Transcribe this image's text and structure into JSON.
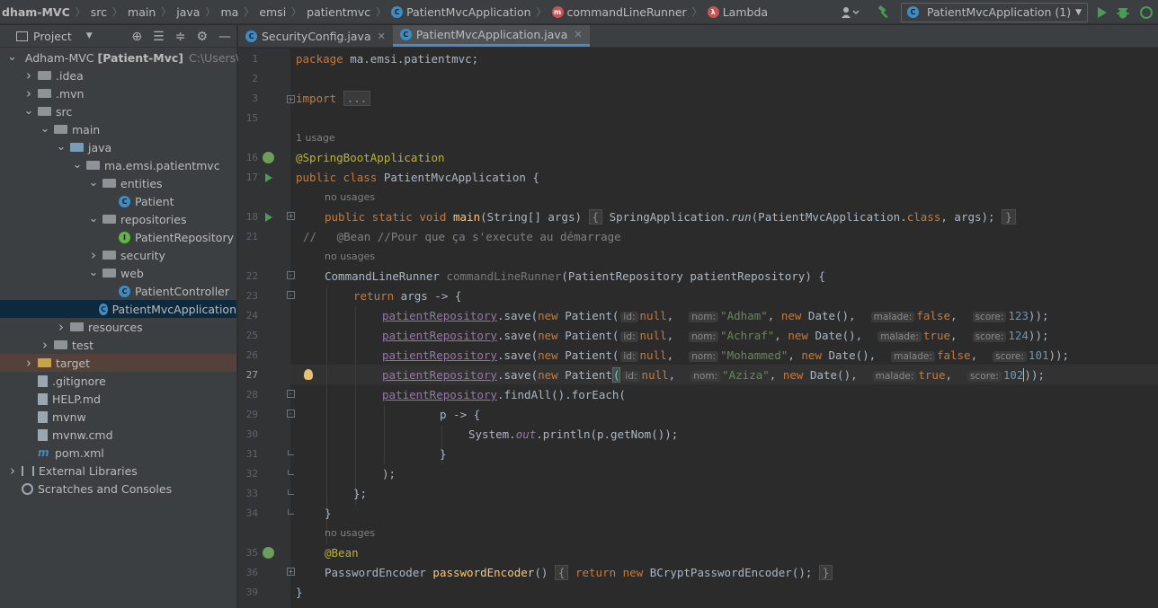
{
  "breadcrumbs": [
    {
      "label": "dham-MVC",
      "bold": true
    },
    {
      "label": "src"
    },
    {
      "label": "main"
    },
    {
      "label": "java"
    },
    {
      "label": "ma"
    },
    {
      "label": "emsi"
    },
    {
      "label": "patientmvc"
    },
    {
      "label": "PatientMvcApplication",
      "icon": "class-icon"
    },
    {
      "label": "commandLineRunner",
      "icon": "method-icon"
    },
    {
      "label": "Lambda",
      "icon": "lambda-icon"
    }
  ],
  "toolbar": {
    "run_config": "PatientMvcApplication (1)"
  },
  "project_panel": {
    "title": "Project",
    "tree": [
      {
        "depth": 0,
        "arrow": "down",
        "icon": "module",
        "label": "Adham-MVC",
        "bold_label": "[Patient-Mvc]",
        "hint": "C:\\Users\\as"
      },
      {
        "depth": 1,
        "arrow": "right",
        "icon": "folder",
        "label": ".idea"
      },
      {
        "depth": 1,
        "arrow": "right",
        "icon": "folder",
        "label": ".mvn"
      },
      {
        "depth": 1,
        "arrow": "down",
        "icon": "folder",
        "label": "src"
      },
      {
        "depth": 2,
        "arrow": "down",
        "icon": "folder",
        "label": "main"
      },
      {
        "depth": 3,
        "arrow": "down",
        "icon": "folder-src",
        "label": "java"
      },
      {
        "depth": 4,
        "arrow": "down",
        "icon": "folder",
        "label": "ma.emsi.patientmvc"
      },
      {
        "depth": 5,
        "arrow": "down",
        "icon": "folder",
        "label": "entities"
      },
      {
        "depth": 6,
        "arrow": "",
        "icon": "class",
        "label": "Patient"
      },
      {
        "depth": 5,
        "arrow": "down",
        "icon": "folder",
        "label": "repositories"
      },
      {
        "depth": 6,
        "arrow": "",
        "icon": "interface",
        "label": "PatientRepository"
      },
      {
        "depth": 5,
        "arrow": "right",
        "icon": "folder",
        "label": "security"
      },
      {
        "depth": 5,
        "arrow": "down",
        "icon": "folder",
        "label": "web"
      },
      {
        "depth": 6,
        "arrow": "",
        "icon": "class",
        "label": "PatientController"
      },
      {
        "depth": 5,
        "arrow": "",
        "icon": "class",
        "label": "PatientMvcApplication",
        "selected": true
      },
      {
        "depth": 3,
        "arrow": "right",
        "icon": "folder",
        "label": "resources"
      },
      {
        "depth": 2,
        "arrow": "right",
        "icon": "folder",
        "label": "test"
      },
      {
        "depth": 1,
        "arrow": "right",
        "icon": "folder-orange",
        "label": "target",
        "excluded": true
      },
      {
        "depth": 1,
        "arrow": "",
        "icon": "file",
        "label": ".gitignore"
      },
      {
        "depth": 1,
        "arrow": "",
        "icon": "file",
        "label": "HELP.md"
      },
      {
        "depth": 1,
        "arrow": "",
        "icon": "file",
        "label": "mvnw"
      },
      {
        "depth": 1,
        "arrow": "",
        "icon": "file",
        "label": "mvnw.cmd"
      },
      {
        "depth": 1,
        "arrow": "",
        "icon": "pom",
        "label": "pom.xml"
      },
      {
        "depth": 0,
        "arrow": "right",
        "icon": "library",
        "label": "External Libraries"
      },
      {
        "depth": 0,
        "arrow": "",
        "icon": "scratch",
        "label": "Scratches and Consoles"
      }
    ]
  },
  "tabs": [
    {
      "label": "SecurityConfig.java",
      "active": false
    },
    {
      "label": "PatientMvcApplication.java",
      "active": true
    }
  ],
  "editor": {
    "line_numbers": [
      "1",
      "2",
      "3",
      "15",
      "16",
      "17",
      "18",
      "21",
      "22",
      "23",
      "24",
      "25",
      "26",
      "27",
      "28",
      "29",
      "30",
      "31",
      "32",
      "33",
      "34",
      "35",
      "36",
      "39"
    ],
    "current_line": "27",
    "usage_hints": [
      "1 usage",
      "no usages",
      "no usages",
      "no usages"
    ],
    "code": {
      "package_kw": "package",
      "package_name": " ma.emsi.patientmvc;",
      "import_kw": "import",
      "import_fold": "...",
      "spring_boot_app": "@SpringBootApplication",
      "public_class": "public class",
      "class_name": " PatientMvcApplication {",
      "main_mods": "public static void",
      "main_name": "main",
      "main_params": "(String[] args)",
      "main_body_open": "{",
      "spring_app": " SpringApplication.",
      "run": "run",
      "run_args": "(PatientMvcApplication.",
      "class_kw": "class",
      "run_args_end": ", args);",
      "main_body_close": "}",
      "comment": "//   @Bean //Pour que ça s'execute au démarrage",
      "clr_type": "CommandLineRunner ",
      "clr_name": "commandLineRunner",
      "clr_params": "(PatientRepository patientRepository) {",
      "return_kw": "return",
      "lambda_start": " args -> {",
      "repo": "patientRepository",
      "save": ".save(",
      "new_kw": "new",
      "patient_ctor": " Patient(",
      "hint_id": "id:",
      "hint_nom": "nom:",
      "hint_malade": "malade:",
      "hint_score": "score:",
      "null_kw": "null",
      "new_date": " Date(),",
      "rows": [
        {
          "nom": "\"Adham\"",
          "malade": "false",
          "score": "123"
        },
        {
          "nom": "\"Achraf\"",
          "malade": "true",
          "score": "124"
        },
        {
          "nom": "\"Mohammed\"",
          "malade": "false",
          "score": "101"
        },
        {
          "nom": "\"Aziza\"",
          "malade": "true",
          "score": "102"
        }
      ],
      "find_all": ".findAll().forEach(",
      "p_lambda": "p -> {",
      "sysout_1": "System.",
      "sysout_out": "out",
      "sysout_2": ".println(p.getNom());",
      "close_brace": "}",
      "close_paren": ");",
      "close_lambda": "};",
      "bean": "@Bean",
      "pe_type": "PasswordEncoder ",
      "pe_name": "passwordEncoder",
      "pe_params": "()",
      "pe_body_open": "{",
      "pe_body": " BCryptPasswordEncoder();",
      "pe_body_close": "}"
    }
  }
}
